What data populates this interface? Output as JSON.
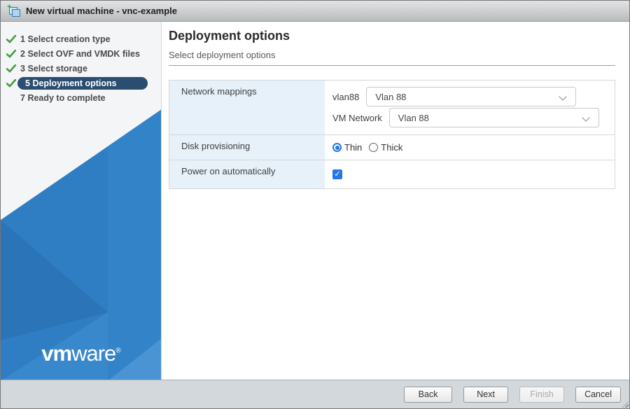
{
  "window": {
    "title": "New virtual machine - vnc-example",
    "icon": "new-vm-icon"
  },
  "sidebar": {
    "steps": [
      {
        "num": "1",
        "label": "Select creation type",
        "completed": true,
        "active": false
      },
      {
        "num": "2",
        "label": "Select OVF and VMDK files",
        "completed": true,
        "active": false
      },
      {
        "num": "3",
        "label": "Select storage",
        "completed": true,
        "active": false
      },
      {
        "num": "5",
        "label": "Deployment options",
        "completed": true,
        "active": true
      },
      {
        "num": "7",
        "label": "Ready to complete",
        "completed": false,
        "active": false
      }
    ],
    "brand": {
      "bold": "vm",
      "light": "ware",
      "registered": "®"
    }
  },
  "main": {
    "title": "Deployment options",
    "subtitle": "Select deployment options"
  },
  "form": {
    "network_mappings": {
      "label": "Network mappings",
      "mappings": [
        {
          "name": "vlan88",
          "value": "Vlan 88"
        },
        {
          "name": "VM Network",
          "value": "Vlan 88"
        }
      ]
    },
    "disk_provisioning": {
      "label": "Disk provisioning",
      "options": [
        {
          "label": "Thin",
          "selected": true
        },
        {
          "label": "Thick",
          "selected": false
        }
      ]
    },
    "power_on": {
      "label": "Power on automatically",
      "checked": true,
      "check_glyph": "✓"
    }
  },
  "footer": {
    "buttons": [
      {
        "label": "Back",
        "enabled": true
      },
      {
        "label": "Next",
        "enabled": true
      },
      {
        "label": "Finish",
        "enabled": false
      },
      {
        "label": "Cancel",
        "enabled": true
      }
    ]
  },
  "colors": {
    "accent_blue": "#2577e5",
    "sidebar_blue": "#2f7ec4",
    "sidebar_blue_bright": "#3383c9",
    "sidebar_blue_dark": "#2a74b7",
    "active_step_pill": "#2a4d70",
    "check_green": "#42a03c",
    "label_cell_bg": "#e6f1fa",
    "footer_bg": "#d3d8dd"
  }
}
